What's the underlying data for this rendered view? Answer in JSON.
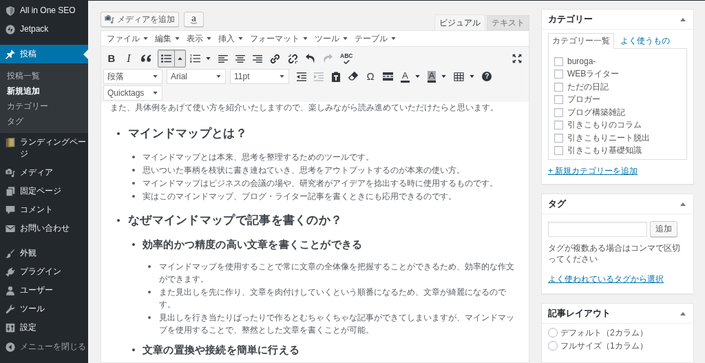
{
  "sidebar": {
    "groups": [
      {
        "items": [
          {
            "label": "All in One SEO",
            "selected": false
          },
          {
            "label": "Jetpack",
            "selected": false
          }
        ]
      },
      {
        "items": [
          {
            "label": "投稿",
            "selected": true,
            "submenu": [
              {
                "label": "投稿一覧",
                "selected": false
              },
              {
                "label": "新規追加",
                "selected": true
              },
              {
                "label": "カテゴリー",
                "selected": false
              },
              {
                "label": "タグ",
                "selected": false
              }
            ]
          },
          {
            "label": "ランディングページ",
            "selected": false
          },
          {
            "label": "メディア",
            "selected": false
          },
          {
            "label": "固定ページ",
            "selected": false
          },
          {
            "label": "コメント",
            "selected": false
          },
          {
            "label": "お問い合わせ",
            "selected": false
          }
        ]
      },
      {
        "items": [
          {
            "label": "外観",
            "selected": false
          },
          {
            "label": "プラグイン",
            "selected": false
          },
          {
            "label": "ユーザー",
            "selected": false
          },
          {
            "label": "ツール",
            "selected": false
          },
          {
            "label": "設定",
            "selected": false
          }
        ]
      }
    ],
    "collapse_label": "メニューを閉じる"
  },
  "editor": {
    "media_buttons": [
      {
        "kind": "media",
        "label": "メディアを追加"
      },
      {
        "kind": "logo",
        "label": "a"
      }
    ],
    "tabs": [
      {
        "label": "ビジュアル",
        "selected": true
      },
      {
        "label": "テキスト",
        "selected": false
      }
    ],
    "menubar": [
      "ファイル",
      "編集",
      "表示",
      "挿入",
      "フォーマット",
      "ツール",
      "テーブル"
    ],
    "toolbars": [
      [
        {
          "kind": "bold",
          "label": "B",
          "pressed": false,
          "disabled": false
        },
        {
          "kind": "italic",
          "label": "I",
          "pressed": false,
          "disabled": false
        },
        {
          "kind": "quote",
          "pressed": false,
          "disabled": false
        },
        {
          "kind": "bullet-list",
          "menu": true,
          "pressed": true,
          "disabled": false
        },
        {
          "kind": "number-list",
          "menu": true,
          "pressed": false,
          "disabled": false
        },
        {
          "kind": "align-left",
          "pressed": false,
          "disabled": false
        },
        {
          "kind": "align-center",
          "pressed": false,
          "disabled": false
        },
        {
          "kind": "align-right",
          "pressed": false,
          "disabled": false
        },
        {
          "kind": "link",
          "pressed": false,
          "disabled": false
        },
        {
          "kind": "unlink",
          "pressed": false,
          "disabled": false
        },
        {
          "kind": "undo",
          "pressed": false,
          "disabled": false
        },
        {
          "kind": "redo",
          "pressed": false,
          "disabled": true
        },
        {
          "kind": "spellcheck",
          "label": "ABC",
          "disabled": false
        },
        {
          "kind": "fullscreen",
          "pressed": false,
          "disabled": false
        }
      ],
      [
        {
          "kind": "select",
          "value": "段落"
        },
        {
          "kind": "select",
          "value": "Arial"
        },
        {
          "kind": "select",
          "value": "11pt"
        },
        {
          "kind": "outdent",
          "pressed": false,
          "disabled": false
        },
        {
          "kind": "indent",
          "pressed": false,
          "disabled": true
        },
        {
          "kind": "paste-text",
          "pressed": false,
          "disabled": false
        },
        {
          "kind": "clear-format",
          "pressed": false,
          "disabled": false
        },
        {
          "kind": "symbol",
          "label": "Ω",
          "pressed": false,
          "disabled": false
        },
        {
          "kind": "read-more",
          "pressed": false,
          "disabled": false
        },
        {
          "kind": "text-color",
          "label": "A",
          "menu": true,
          "pressed": false,
          "disabled": false
        },
        {
          "kind": "highlight",
          "label": "A",
          "menu": true,
          "pressed": false,
          "disabled": false
        },
        {
          "kind": "table",
          "menu": true,
          "pressed": false,
          "disabled": false
        },
        {
          "kind": "help",
          "label": "?",
          "pressed": false,
          "disabled": false
        }
      ],
      [
        {
          "kind": "select",
          "value": "Quicktags"
        }
      ]
    ],
    "content": {
      "intro": "また、具体例をあげて使い方を紹介いたしますので、楽しみながら読み進めていただけたらと思います。",
      "outline": [
        {
          "kind": "heading",
          "text": "マインドマップとは？",
          "children": [
            {
              "kind": "item",
              "text": "マインドマップとは本来、思考を整理するためのツールです。"
            },
            {
              "kind": "item",
              "text": "思いついた事柄を枝状に書き連ねていき、思考をアウトプットするのが本来の使い方。"
            },
            {
              "kind": "item",
              "text": "マインドマップはビジネスの会議の場や、研究者がアイデアを捻出する時に使用するものです。"
            },
            {
              "kind": "item",
              "text": "実はこのマインドマップ、ブログ・ライター記事を書くときにも応用できるのです。"
            }
          ]
        },
        {
          "kind": "heading",
          "text": "なぜマインドマップで記事を書くのか？",
          "children": [
            {
              "kind": "subheading",
              "text": "効率的かつ精度の高い文章を書くことができる",
              "children": [
                {
                  "kind": "item",
                  "text": "マインドマップを使用することで常に文章の全体像を把握することができるため、効率的な作文ができます。"
                },
                {
                  "kind": "item",
                  "text": "また見出しを先に作り、文章を肉付けしていくという順番になるため、文章が綺麗になるのです。"
                },
                {
                  "kind": "item",
                  "text": "見出しを行き当たりばったりで作るとむちゃくちゃな記事ができてしまいますが、マインドマップを使用することで、整然とした文章を書くことが可能。"
                }
              ]
            },
            {
              "kind": "subheading",
              "text": "文章の置換や接続を簡単に行える"
            }
          ]
        }
      ]
    }
  },
  "categories": {
    "title": "カテゴリー",
    "expanded": true,
    "tabs": [
      {
        "label": "カテゴリー一覧",
        "selected": true
      },
      {
        "label": "よく使うもの",
        "selected": false
      }
    ],
    "items": [
      {
        "label": "buroga-",
        "checked": false
      },
      {
        "label": "WEBライター",
        "checked": false
      },
      {
        "label": "ただの日記",
        "checked": false
      },
      {
        "label": "ブロガー",
        "checked": false
      },
      {
        "label": "ブログ構築雑記",
        "checked": false
      },
      {
        "label": "引きこもりのコラム",
        "checked": false
      },
      {
        "label": "引きこもりニート脱出",
        "checked": false
      },
      {
        "label": "引きこもり基礎知識",
        "checked": false
      }
    ],
    "add_link": "+ 新規カテゴリーを追加"
  },
  "tags": {
    "title": "タグ",
    "expanded": true,
    "add_button": "追加",
    "hint": "タグが複数ある場合はコンマで区切ってください",
    "link": "よく使われているタグから選択"
  },
  "layout": {
    "title": "記事レイアウト",
    "expanded": true,
    "options": [
      {
        "label": "デフォルト（2カラム）",
        "selected": false
      },
      {
        "label": "フルサイズ（1カラム）",
        "selected": false
      }
    ]
  }
}
